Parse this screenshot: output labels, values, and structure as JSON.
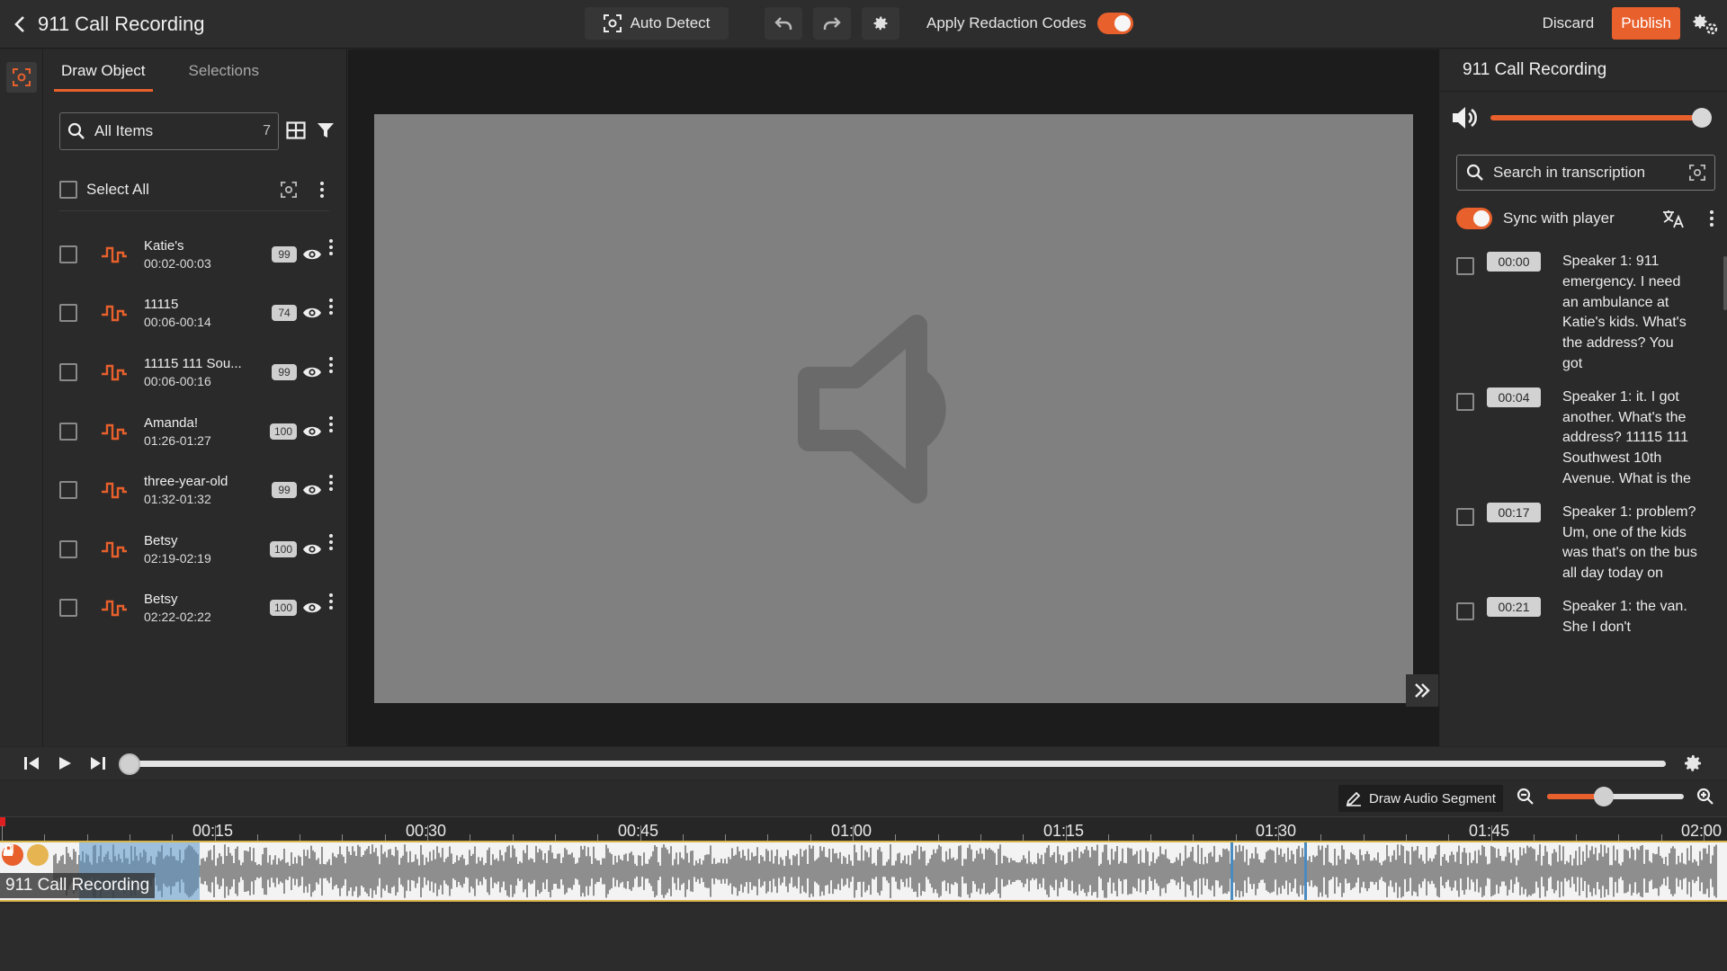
{
  "header": {
    "title": "911 Call Recording",
    "auto_detect": "Auto Detect",
    "apply_redaction_codes": "Apply Redaction Codes",
    "discard": "Discard",
    "publish": "Publish"
  },
  "left_panel": {
    "tabs": [
      {
        "label": "Draw Object"
      },
      {
        "label": "Selections"
      }
    ],
    "search_label": "All Items",
    "count": "7",
    "select_all": "Select All",
    "items": [
      {
        "name": "Katie's",
        "time": "00:02-00:03",
        "score": "99"
      },
      {
        "name": "11115",
        "time": "00:06-00:14",
        "score": "74"
      },
      {
        "name": "11115 111 Sou...",
        "time": "00:06-00:16",
        "score": "99"
      },
      {
        "name": "Amanda!",
        "time": "01:26-01:27",
        "score": "100"
      },
      {
        "name": "three-year-old",
        "time": "01:32-01:32",
        "score": "99"
      },
      {
        "name": "Betsy",
        "time": "02:19-02:19",
        "score": "100"
      },
      {
        "name": "Betsy",
        "time": "02:22-02:22",
        "score": "100"
      }
    ]
  },
  "right_panel": {
    "title": "911 Call Recording",
    "volume": 1.0,
    "search_placeholder": "Search in transcription",
    "sync_label": "Sync with player",
    "transcript": [
      {
        "time": "00:00",
        "text": "Speaker 1: 911 emergency. I need an ambulance at Katie's kids. What's the address? You got"
      },
      {
        "time": "00:04",
        "text": "Speaker 1: it. I got another. What's the address? 11115 111 Southwest 10th Avenue. What is the"
      },
      {
        "time": "00:17",
        "text": "Speaker 1: problem? Um, one of the kids was that's on the bus all day today on"
      },
      {
        "time": "00:21",
        "text": "Speaker 1: the van. She I don't"
      }
    ]
  },
  "timeline": {
    "draw_audio_segment": "Draw Audio Segment",
    "zoom_level": 0.37,
    "ruler_labels": [
      "00:15",
      "00:30",
      "00:45",
      "01:00",
      "01:15",
      "01:30",
      "01:45",
      "02:00"
    ],
    "track_name": "911 Call Recording",
    "playback_position": 0.0
  },
  "colors": {
    "accent": "#e8602c",
    "background": "#262626",
    "panel": "#2a2a2a",
    "player": "#808080"
  },
  "icons": {
    "back": "chevron-left-icon",
    "auto_detect": "focus-frame-icon",
    "undo": "undo-icon",
    "redo": "redo-icon",
    "settings": "gear-icon",
    "volume": "speaker-icon",
    "translate": "translate-icon"
  }
}
